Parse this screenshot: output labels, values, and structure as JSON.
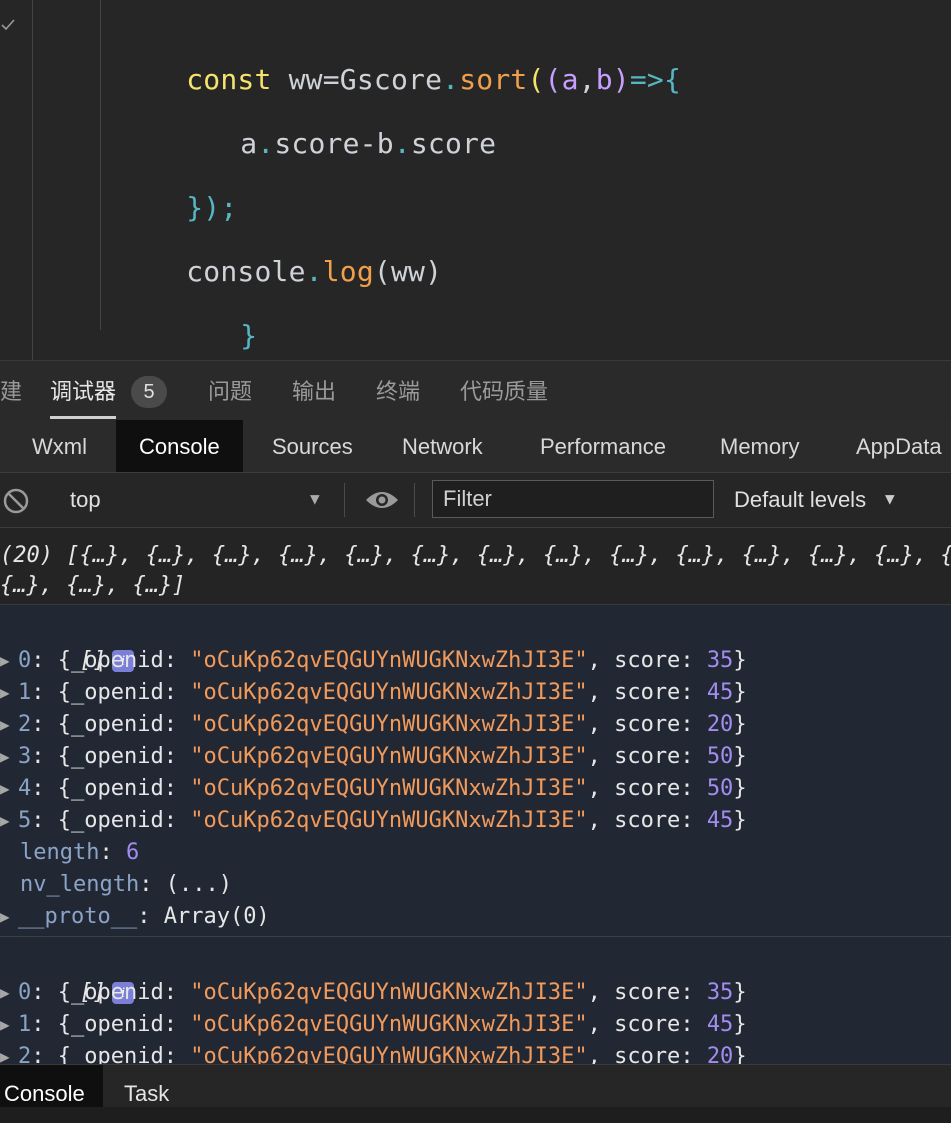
{
  "editor": {
    "lines": [
      {
        "kw": "const",
        "sp": " ",
        "id": "ww",
        "eq": "=",
        "obj": "Gscore",
        "dot": ".",
        "fn": "sort",
        "po": "(",
        "pp": "(",
        "a": "a",
        "comma": ",",
        "b": "b",
        "pc": ")",
        "arrow": "=>",
        "brace": "{"
      },
      {
        "text_a": "a",
        "dot1": ".",
        "prop1": "score",
        "minus": "-",
        "text_b": "b",
        "dot2": ".",
        "prop2": "score"
      },
      {
        "close": "});"
      },
      {
        "obj": "console",
        "dot": ".",
        "fn": "log",
        "po": "(",
        "arg": "ww",
        "pc": ")"
      },
      {
        "close": "}"
      }
    ]
  },
  "panel_tabs": {
    "partial": "建",
    "debugger": "调试器",
    "badge": "5",
    "problems": "问题",
    "output": "输出",
    "terminal": "终端",
    "code_quality": "代码质量"
  },
  "dev_tabs": [
    "Wxml",
    "Console",
    "Sources",
    "Network",
    "Performance",
    "Memory",
    "AppData"
  ],
  "toolbar": {
    "context": "top",
    "filter_placeholder": "Filter",
    "levels": "Default levels"
  },
  "console": {
    "summary_line1": "(20) [{…}, {…}, {…}, {…}, {…}, {…}, {…}, {…}, {…}, {…}, {…}, {…}, {…}, {…",
    "summary_line2": "{…}, {…}, {…}]",
    "group1": {
      "header": "[]",
      "info": "i",
      "items": [
        {
          "idx": "0",
          "openid": "\"oCuKp62qvEQGUYnWUGKNxwZhJI3E\"",
          "score": "35"
        },
        {
          "idx": "1",
          "openid": "\"oCuKp62qvEQGUYnWUGKNxwZhJI3E\"",
          "score": "45"
        },
        {
          "idx": "2",
          "openid": "\"oCuKp62qvEQGUYnWUGKNxwZhJI3E\"",
          "score": "20"
        },
        {
          "idx": "3",
          "openid": "\"oCuKp62qvEQGUYnWUGKNxwZhJI3E\"",
          "score": "50"
        },
        {
          "idx": "4",
          "openid": "\"oCuKp62qvEQGUYnWUGKNxwZhJI3E\"",
          "score": "50"
        },
        {
          "idx": "5",
          "openid": "\"oCuKp62qvEQGUYnWUGKNxwZhJI3E\"",
          "score": "45"
        }
      ],
      "length_key": "length",
      "length_val": "6",
      "nv_key": "nv_length",
      "nv_val": "(...)",
      "proto_key": "__proto__",
      "proto_val": "Array(0)"
    },
    "group2": {
      "header": "[]",
      "info": "i",
      "items": [
        {
          "idx": "0",
          "openid": "\"oCuKp62qvEQGUYnWUGKNxwZhJI3E\"",
          "score": "35"
        },
        {
          "idx": "1",
          "openid": "\"oCuKp62qvEQGUYnWUGKNxwZhJI3E\"",
          "score": "45"
        },
        {
          "idx": "2",
          "openid": "\"oCuKp62qvEQGUYnWUGKNxwZhJI3E\"",
          "score": "20"
        }
      ]
    },
    "labels": {
      "openid_key": "_openid",
      "score_key": "score"
    }
  },
  "bottom_tabs": [
    "Console",
    "Task"
  ],
  "colors": {
    "string": "#f19a5b",
    "number": "#a18cf0",
    "keyword": "#f5e36a",
    "function": "#f0a04b"
  }
}
